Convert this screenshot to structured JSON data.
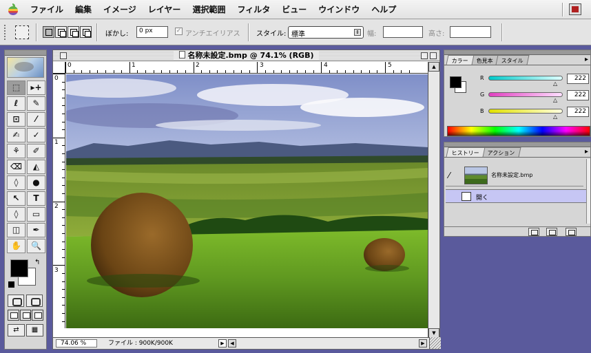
{
  "menu": {
    "items": [
      "ファイル",
      "編集",
      "イメージ",
      "レイヤー",
      "選択範囲",
      "フィルタ",
      "ビュー",
      "ウインドウ",
      "ヘルプ"
    ]
  },
  "options": {
    "feather_label": "ぼかし:",
    "feather_value": "0 px",
    "antialias_label": "アンチエイリアス",
    "style_label": "スタイル:",
    "style_value": "標準",
    "width_label": "幅:",
    "height_label": "高さ:"
  },
  "toolbox": {
    "tools": [
      "⬚",
      "▸+",
      "ℓ",
      "✎",
      "⊡",
      "⁄",
      "✍",
      "✓",
      "⚘",
      "✐",
      "⌫",
      "◭",
      "◊",
      "●",
      "↖",
      "T",
      "◊",
      "▭",
      "◫",
      "✒",
      "✋",
      "🔍"
    ],
    "swap_label": "↰"
  },
  "document": {
    "title": "名称未設定.bmp @ 74.1% (RGB)",
    "ruler_h_labels": [
      "0",
      "1",
      "2",
      "3",
      "4",
      "5"
    ],
    "ruler_v_labels": [
      "0",
      "1",
      "2",
      "3"
    ],
    "zoom": "74.06 %",
    "file_info": "ファイル : 900K/900K"
  },
  "color_palette": {
    "tabs": [
      "カラー",
      "色見本",
      "スタイル"
    ],
    "active_tab": "カラー",
    "sliders": [
      {
        "label": "R",
        "value": "222",
        "gradient": "#00c8c8"
      },
      {
        "label": "G",
        "value": "222",
        "gradient": "#e040c0"
      },
      {
        "label": "B",
        "value": "222",
        "gradient": "#e0e000"
      }
    ]
  },
  "history_palette": {
    "tabs": [
      "ヒストリー",
      "アクション"
    ],
    "active_tab": "ヒストリー",
    "snapshot_label": "名称未設定.bmp",
    "state_label": "開く"
  }
}
